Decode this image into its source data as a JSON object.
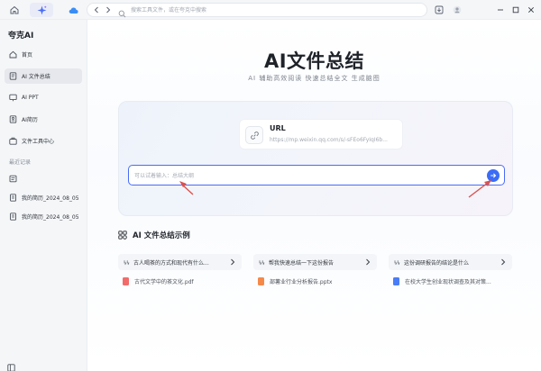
{
  "titlebar": {
    "search_placeholder": "搜索工具文件，或在夸克中搜索"
  },
  "sidebar": {
    "brand": "夸克AI",
    "items": [
      {
        "label": "首页",
        "icon": "home-icon",
        "active": false
      },
      {
        "label": "AI 文件总结",
        "icon": "document-summary-icon",
        "active": true
      },
      {
        "label": "AI PPT",
        "icon": "ppt-icon",
        "active": false
      },
      {
        "label": "AI简历",
        "icon": "resume-icon",
        "active": false
      },
      {
        "label": "文件工具中心",
        "icon": "toolbox-icon",
        "active": false
      }
    ],
    "recent_title": "最近记录",
    "recent": [
      {
        "label": "",
        "icon": "file-icon"
      },
      {
        "label": "我的简历_2024_08_05",
        "icon": "resume-file-icon"
      },
      {
        "label": "我的简历_2024_08_05",
        "icon": "resume-file-icon"
      }
    ]
  },
  "hero": {
    "title": "AI文件总结",
    "subtitle": "AI 辅助高效阅读   快速总结全文   生成脑图"
  },
  "url_card": {
    "title": "URL",
    "value": "https://mp.weixin.qq.com/s/-sFEo6FyIqI6b..."
  },
  "input": {
    "placeholder": "可以试着输入：总结大纲"
  },
  "examples": {
    "title": "AI 文件总结示例",
    "items": [
      {
        "question": "古人喝茶的方式和现代有什么...",
        "file": "古代文学中的茶文化.pdf",
        "file_type": "pdf",
        "file_color": "#f26b6b"
      },
      {
        "question": "帮我快速总结一下这份报告",
        "file": "部薯业行业分析报告.pptx",
        "file_type": "pptx",
        "file_color": "#f5894a"
      },
      {
        "question": "这份调研报告的结论是什么",
        "file": "在校大学生创业现状调查及其对策...",
        "file_type": "doc",
        "file_color": "#4a7cf6"
      }
    ]
  },
  "colors": {
    "accent": "#3b6cf6",
    "arrow": "#d9534f"
  }
}
